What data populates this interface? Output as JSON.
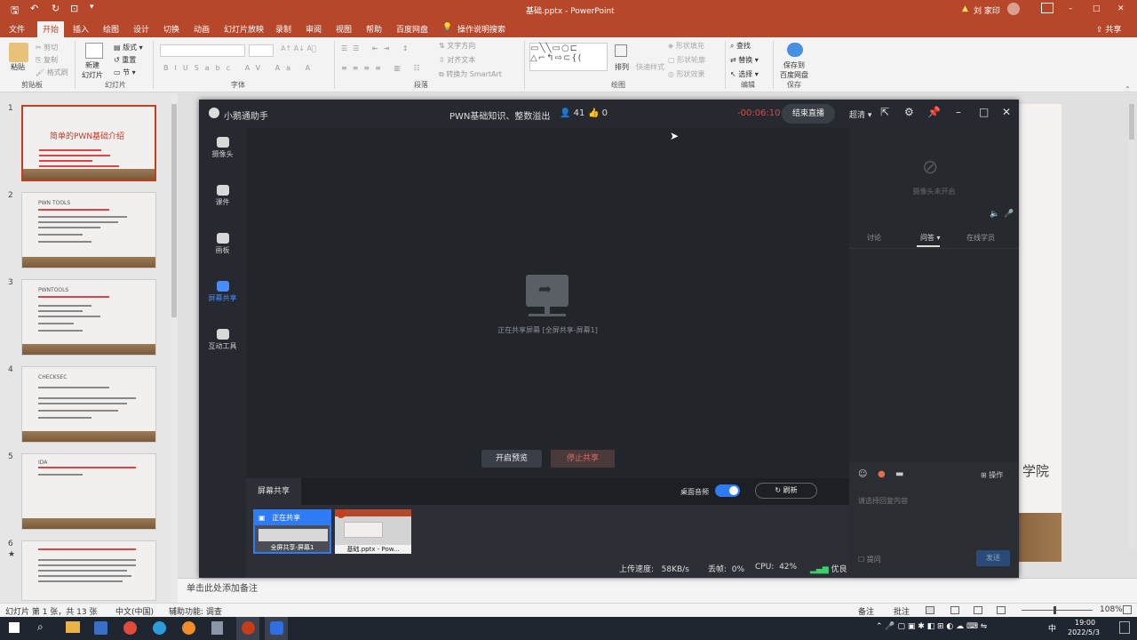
{
  "titlebar": {
    "filename": "基础.pptx",
    "sep": "-",
    "app": "PowerPoint",
    "warning": "▲",
    "user": "刘 家印",
    "min": "–",
    "max": "□",
    "close": "✕"
  },
  "tabs": [
    "文件",
    "开始",
    "插入",
    "绘图",
    "设计",
    "切换",
    "动画",
    "幻灯片放映",
    "录制",
    "审阅",
    "视图",
    "帮助",
    "百度网盘"
  ],
  "tab_search": "操作说明搜索",
  "share": "共享",
  "ribbon": {
    "paste": "粘贴",
    "cut": "剪切",
    "copy": "复制",
    "format_painter": "格式刷",
    "clipboard": "剪贴板",
    "new_slide": "新建\n幻灯片",
    "layout": "版式",
    "reset": "重置",
    "section": "节",
    "slides": "幻灯片",
    "font_group": "字体",
    "paragraph": "段落",
    "text_direction": "文字方向",
    "align_text": "对齐文本",
    "smartart": "转换为 SmartArt",
    "arrange": "排列",
    "quick_styles": "快速样式",
    "shape_fill": "形状填充",
    "shape_outline": "形状轮廓",
    "shape_effect": "形状效果",
    "drawing": "绘图",
    "find": "查找",
    "replace": "替换",
    "select": "选择",
    "editing": "编辑",
    "save_baidu": "保存到\n百度网盘",
    "save": "保存"
  },
  "thumbnails": [
    {
      "num": "1",
      "title": "简单的PWN基础介绍"
    },
    {
      "num": "2",
      "title": "PWN TOOLS"
    },
    {
      "num": "3",
      "title": "PWNTOOLS"
    },
    {
      "num": "4",
      "title": "CHECKSEC"
    },
    {
      "num": "5",
      "title": "IDA"
    },
    {
      "num": "6",
      "title": "",
      "star": "★"
    }
  ],
  "notes": "单击此处添加备注",
  "status": {
    "slide": "幻灯片 第 1 张，共 13 张",
    "lang": "中文(中国)",
    "accessibility": "辅助功能: 调查",
    "notes_btn": "备注",
    "comments_btn": "批注",
    "zoom": "108%"
  },
  "taskbar": {
    "time": "19:00",
    "date": "2022/5/3",
    "lang": "中"
  },
  "app": {
    "name": "小鹅通助手",
    "course": "PWN基础知识、整数溢出",
    "people": "41",
    "likes": "0",
    "timer": "-00:06:10",
    "end_live": "结束直播",
    "quality": "超清",
    "side": [
      {
        "label": "摄像头"
      },
      {
        "label": "课件"
      },
      {
        "label": "画板"
      },
      {
        "label": "屏幕共享"
      },
      {
        "label": "互动工具"
      }
    ],
    "stage_text": "正在共享屏幕 [全屏共享-屏幕1]",
    "preview_btn": "开启预览",
    "stop_btn": "停止共享",
    "share_title": "屏幕共享",
    "desktop_audio": "桌面音频",
    "refresh": "刷新",
    "share_items": [
      {
        "label": "全屏共享-屏幕1",
        "badge": "正在共享"
      },
      {
        "label": "基础.pptx - Pow..."
      }
    ],
    "upload_label": "上传速度:",
    "upload": "58KB/s",
    "loss_label": "丢帧:",
    "loss": "0%",
    "cpu_label": "CPU:",
    "cpu": "42%",
    "net": "优良",
    "camera_off": "摄像头未开启",
    "right_tabs": [
      "讨论",
      "问答",
      "在线学员"
    ],
    "more_ops": "操作",
    "input_ph": "请选择回复内容",
    "ask": "提问",
    "send": "发送"
  },
  "slide_fragment": "学院"
}
